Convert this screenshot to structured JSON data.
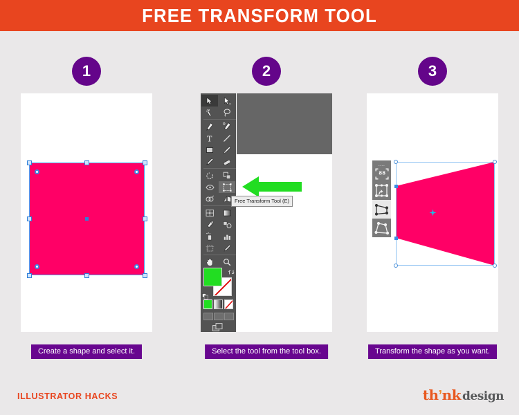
{
  "header": {
    "title": "FREE TRANSFORM TOOL",
    "bg_color": "#e8451f",
    "text_color": "#ffffff"
  },
  "theme": {
    "page_bg": "#eae8e9",
    "accent_orange": "#e8451f",
    "accent_purple": "#68068f",
    "shape_pink": "#ff0066",
    "arrow_green": "#22dd22",
    "selection_blue": "#4aa3f7"
  },
  "steps": [
    {
      "number": "1",
      "caption": "Create a shape and select it.",
      "canvas_kind": "selected-square"
    },
    {
      "number": "2",
      "caption": "Select the tool from the tool box.",
      "canvas_kind": "illustrator-toolbar"
    },
    {
      "number": "3",
      "caption": "Transform the shape as you want.",
      "canvas_kind": "transformed-shape"
    }
  ],
  "illustrator": {
    "tooltip": "Free Transform Tool (E)",
    "fill_color": "#22dd22",
    "stroke_color": "none",
    "tools": [
      {
        "row": 0,
        "left": "selection-tool",
        "right": "direct-selection-tool",
        "selected": "left"
      },
      {
        "row": 1,
        "left": "magic-wand-tool",
        "right": "lasso-tool",
        "selected": ""
      },
      {
        "row": 2,
        "left": "pen-tool",
        "right": "curvature-tool",
        "selected": ""
      },
      {
        "row": 3,
        "left": "type-tool",
        "right": "line-segment-tool",
        "selected": ""
      },
      {
        "row": 4,
        "left": "rectangle-tool",
        "right": "paintbrush-tool",
        "selected": ""
      },
      {
        "row": 5,
        "left": "pencil-tool",
        "right": "eraser-tool",
        "selected": ""
      },
      {
        "row": 6,
        "left": "rotate-tool",
        "right": "scale-tool",
        "selected": ""
      },
      {
        "row": 7,
        "left": "width-tool",
        "right": "free-transform-tool",
        "selected": "right"
      },
      {
        "row": 8,
        "left": "shape-builder-tool",
        "right": "perspective-grid-tool",
        "selected": ""
      },
      {
        "row": 9,
        "left": "mesh-tool",
        "right": "gradient-tool",
        "selected": ""
      },
      {
        "row": 10,
        "left": "eyedropper-tool",
        "right": "blend-tool",
        "selected": ""
      },
      {
        "row": 11,
        "left": "symbol-sprayer-tool",
        "right": "column-graph-tool",
        "selected": ""
      },
      {
        "row": 12,
        "left": "artboard-tool",
        "right": "slice-tool",
        "selected": ""
      },
      {
        "row": 13,
        "left": "hand-tool",
        "right": "zoom-tool",
        "selected": ""
      }
    ],
    "swatches": [
      "color",
      "gradient",
      "none"
    ],
    "draw_modes": [
      "draw-normal",
      "draw-behind",
      "draw-inside"
    ],
    "screen_mode": "change-screen-mode"
  },
  "free_transform_widget": {
    "buttons": [
      {
        "name": "constrain",
        "active": false
      },
      {
        "name": "free-transform",
        "active": false
      },
      {
        "name": "perspective-distort",
        "active": true
      },
      {
        "name": "free-distort",
        "active": false
      }
    ]
  },
  "footer": {
    "tagline": "ILLUSTRATOR HACKS",
    "logo": {
      "part1": "th",
      "mark": "’",
      "part2": "nk",
      "part3": "design"
    }
  }
}
